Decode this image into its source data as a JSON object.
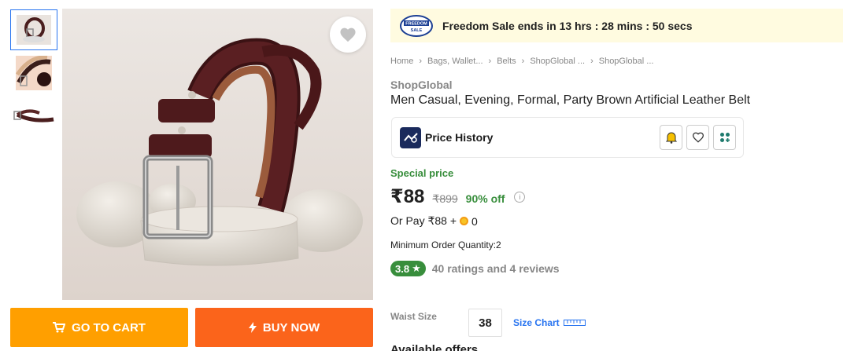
{
  "thumbnails": [
    {
      "icon": "belt-thumbnail-1",
      "active": true
    },
    {
      "icon": "belt-thumbnail-2",
      "active": false
    },
    {
      "icon": "belt-thumbnail-3",
      "active": false
    }
  ],
  "main_image": {
    "icon": "brown-belt-on-rocks",
    "wishlist_icon": "heart-icon"
  },
  "actions": {
    "cart_label": "GO TO CART",
    "buy_label": "BUY NOW"
  },
  "sale_banner": {
    "badge_line1": "FREEDOM",
    "badge_line2": "SALE",
    "text": "Freedom Sale ends in 13 hrs : 28 mins : 50 secs"
  },
  "breadcrumb": [
    "Home",
    "Bags, Wallet...",
    "Belts",
    "ShopGlobal ...",
    "ShopGlobal ..."
  ],
  "product": {
    "brand": "ShopGlobal",
    "title": "Men Casual, Evening, Formal, Party Brown Artificial Leather Belt",
    "price_history_label": "Price History",
    "special_label": "Special price",
    "price": "₹88",
    "mrp": "₹899",
    "discount": "90% off",
    "or_pay_prefix": "Or Pay ₹88 +",
    "or_pay_coins": "0",
    "moq": "Minimum Order Quantity:2",
    "rating": "3.8",
    "rating_text": "40 ratings and 4 reviews",
    "size_label": "Waist Size",
    "size_value": "38",
    "size_chart_label": "Size Chart",
    "offers_heading": "Available offers"
  },
  "colors": {
    "cart": "#ff9f00",
    "buy": "#fb641b",
    "green": "#388e3c",
    "link": "#2874f0",
    "banner_bg": "#fffbe0"
  }
}
